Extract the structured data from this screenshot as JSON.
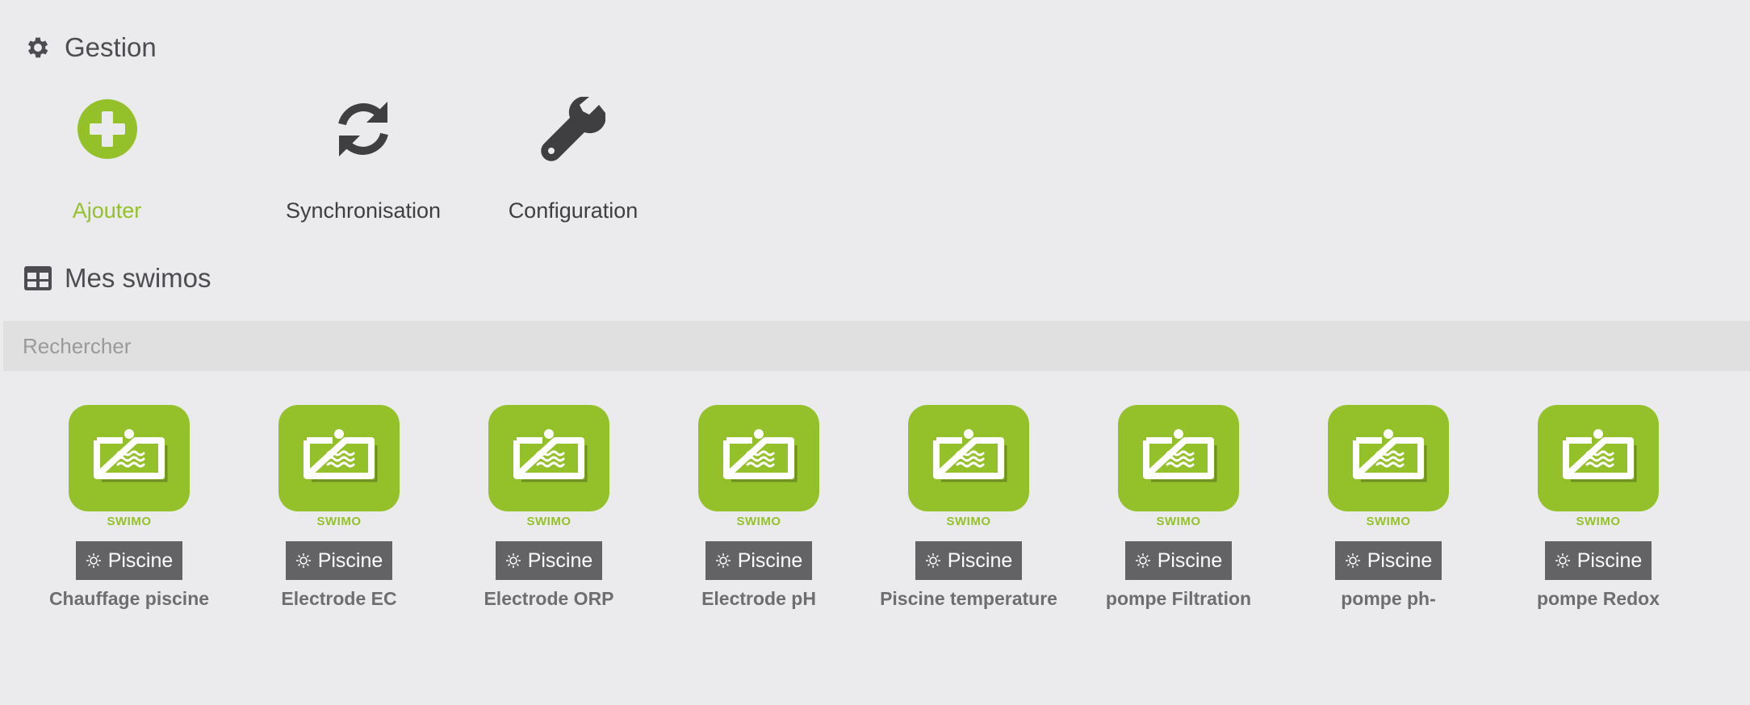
{
  "gestion": {
    "title": "Gestion",
    "icon": "gear-icon",
    "actions": [
      {
        "label": "Ajouter",
        "icon": "plus-circle-icon",
        "color": "#94c12a"
      },
      {
        "label": "Synchronisation",
        "icon": "sync-icon",
        "color": "#3f3f42"
      },
      {
        "label": "Configuration",
        "icon": "wrench-icon",
        "color": "#3f3f42"
      }
    ]
  },
  "swimos": {
    "title": "Mes swimos",
    "icon": "table-icon",
    "search": {
      "placeholder": "Rechercher",
      "value": ""
    },
    "items": [
      {
        "brand": "SWIMO",
        "category": "Piscine",
        "name": "Chauffage piscine"
      },
      {
        "brand": "SWIMO",
        "category": "Piscine",
        "name": "Electrode EC"
      },
      {
        "brand": "SWIMO",
        "category": "Piscine",
        "name": "Electrode ORP"
      },
      {
        "brand": "SWIMO",
        "category": "Piscine",
        "name": "Electrode pH"
      },
      {
        "brand": "SWIMO",
        "category": "Piscine",
        "name": "Piscine temperature"
      },
      {
        "brand": "SWIMO",
        "category": "Piscine",
        "name": "pompe Filtration"
      },
      {
        "brand": "SWIMO",
        "category": "Piscine",
        "name": "pompe ph-"
      },
      {
        "brand": "SWIMO",
        "category": "Piscine",
        "name": "pompe Redox"
      }
    ]
  },
  "colors": {
    "accent": "#94c12a",
    "badge": "#636366",
    "background": "#ebebed"
  }
}
